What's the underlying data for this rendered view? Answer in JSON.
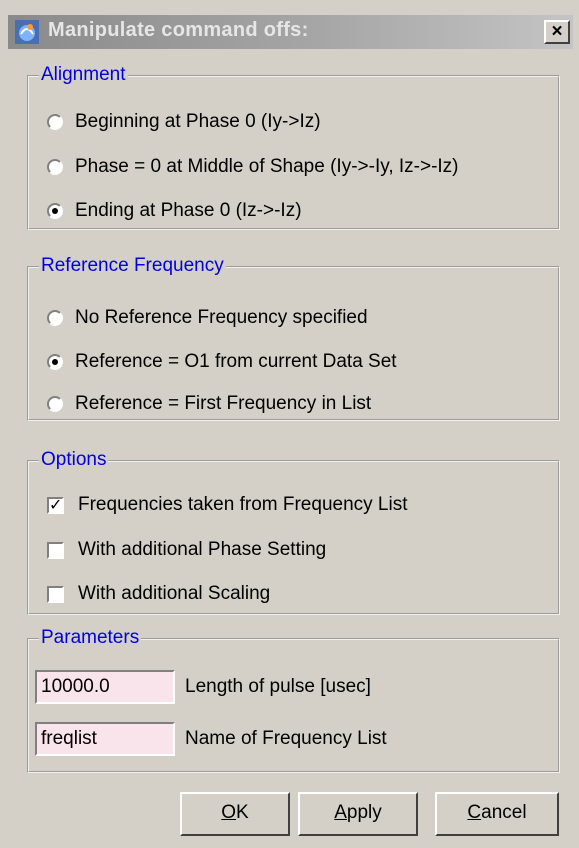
{
  "window": {
    "title": "Manipulate command offs:",
    "close_label": "×"
  },
  "alignment": {
    "legend": "Alignment",
    "options": [
      {
        "label": "Beginning at Phase 0 (Iy->Iz)",
        "selected": false
      },
      {
        "label": "Phase = 0 at Middle of Shape (Iy->-Iy, Iz->-Iz)",
        "selected": false
      },
      {
        "label": "Ending at Phase 0 (Iz->-Iz)",
        "selected": true
      }
    ]
  },
  "reference": {
    "legend": "Reference Frequency",
    "options": [
      {
        "label": "No Reference Frequency specified",
        "selected": false
      },
      {
        "label": "Reference = O1 from current Data Set",
        "selected": true
      },
      {
        "label": "Reference = First Frequency in List",
        "selected": false
      }
    ]
  },
  "options": {
    "legend": "Options",
    "items": [
      {
        "label": "Frequencies taken from Frequency List",
        "checked": true
      },
      {
        "label": "With additional Phase Setting",
        "checked": false
      },
      {
        "label": "With additional Scaling",
        "checked": false
      }
    ]
  },
  "parameters": {
    "legend": "Parameters",
    "fields": [
      {
        "value": "10000.0",
        "label": "Length of pulse [usec]"
      },
      {
        "value": "freqlist",
        "label": "Name of Frequency List"
      }
    ]
  },
  "buttons": {
    "ok": {
      "mnemonic": "O",
      "rest": "K"
    },
    "apply": {
      "mnemonic": "A",
      "rest": "pply"
    },
    "cancel": {
      "mnemonic": "C",
      "rest": "ancel"
    }
  },
  "colors": {
    "legend": "#0000e0",
    "input_bg": "#f8e4ea",
    "dialog_bg": "#d4d0c8"
  }
}
